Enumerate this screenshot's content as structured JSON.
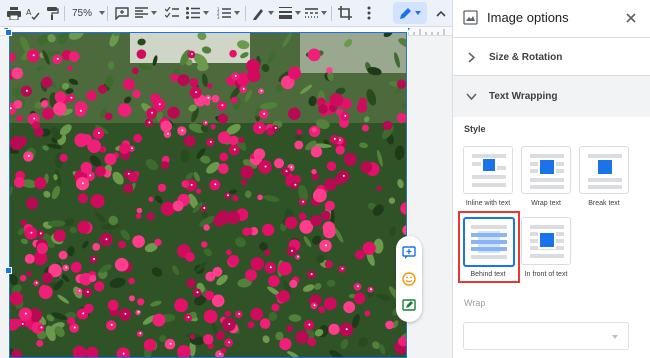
{
  "toolbar": {
    "zoom": "75%",
    "items": [
      "print-icon",
      "spellcheck-icon",
      "paint-format-icon",
      "add-comment-icon",
      "align-left-icon",
      "checklist-icon",
      "bulleted-list-icon",
      "numbered-list-icon",
      "border-color-icon",
      "border-weight-icon",
      "border-dash-icon",
      "crop-icon",
      "editing-mode-icon"
    ]
  },
  "panel": {
    "title": "Image options",
    "sections": {
      "size_rotation": "Size & Rotation",
      "text_wrapping": "Text Wrapping"
    },
    "style_label": "Style",
    "options": [
      {
        "label": "Inline with text",
        "selected": false
      },
      {
        "label": "Wrap text",
        "selected": false
      },
      {
        "label": "Break text",
        "selected": false
      },
      {
        "label": "Behind text",
        "selected": true
      },
      {
        "label": "In front of text",
        "selected": false
      }
    ],
    "wrap_label": "Wrap"
  },
  "side_actions": [
    "add-comment-icon",
    "emoji-reaction-icon",
    "suggest-edits-icon"
  ],
  "colors": {
    "accent": "#1a73e8",
    "highlight": "#e53935",
    "flowers": "#e5106b",
    "foliage": "#2e5a24"
  }
}
